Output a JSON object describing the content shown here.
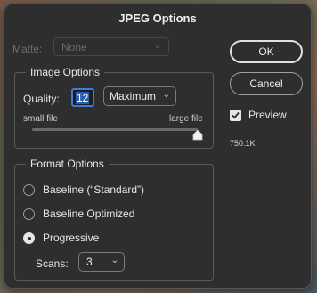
{
  "window": {
    "title": "JPEG Options"
  },
  "matte": {
    "label": "Matte:",
    "value": "None"
  },
  "buttons": {
    "ok": "OK",
    "cancel": "Cancel"
  },
  "image_options": {
    "title": "Image Options",
    "quality_label": "Quality:",
    "quality_value": "12",
    "quality_preset": "Maximum",
    "small_file": "small file",
    "large_file": "large file",
    "slider_fraction": 1.0
  },
  "format_options": {
    "title": "Format Options",
    "options": [
      {
        "label": "Baseline (“Standard”)",
        "checked": false
      },
      {
        "label": "Baseline Optimized",
        "checked": false
      },
      {
        "label": "Progressive",
        "checked": true
      }
    ],
    "scans_label": "Scans:",
    "scans_value": "3"
  },
  "preview": {
    "label": "Preview",
    "checked": true,
    "file_size": "750.1K"
  },
  "colors": {
    "accent": "#3f7bd6",
    "dialog_bg": "#2e2e2e"
  }
}
